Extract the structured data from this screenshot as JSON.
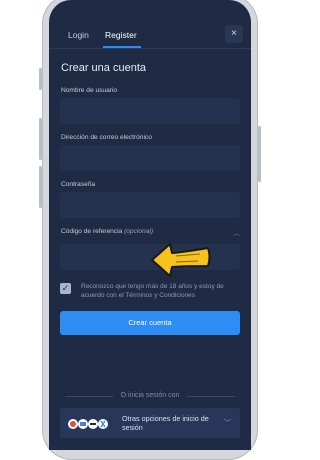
{
  "tabs": [
    {
      "label": "Login"
    },
    {
      "label": "Register"
    }
  ],
  "close_icon": "×",
  "title": "Crear una cuenta",
  "fields": {
    "username_label": "Nombre de usuario",
    "email_label": "Dirección de correo electrónico",
    "password_label": "Contraseña",
    "referral_label": "Código de referencia",
    "referral_optional": "(opcional)"
  },
  "terms": "Reconozco que tengo más de 18 años y estoy de acuerdo con el Términos y Condiciones",
  "create_button": "Crear cuenta",
  "or_text": "O inicia sesión con",
  "other_login": "Otras opciones de inicio de sesión",
  "colors": {
    "accent": "#2e8df5",
    "background": "#1f2b44",
    "arrow": "#f7c21b"
  },
  "icons": [
    "close-icon",
    "chevron-up-icon",
    "checkbox-checked-icon",
    "arrow-pointer-icon",
    "chevron-down-icon",
    "social-logos-icon"
  ]
}
